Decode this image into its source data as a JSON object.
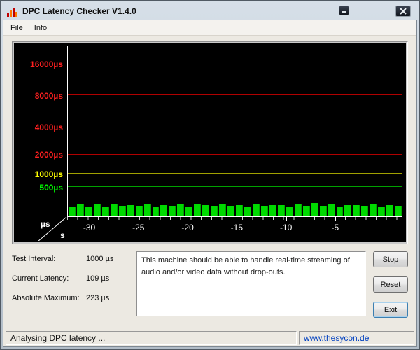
{
  "window": {
    "title": "DPC Latency Checker V1.4.0",
    "icons": {
      "app": "bar-chart-icon",
      "minimize": "minimize-icon",
      "close": "close-icon"
    }
  },
  "menu": {
    "items": [
      {
        "label": "File"
      },
      {
        "label": "Info"
      }
    ]
  },
  "chart_data": {
    "type": "bar",
    "y_scale": "log-like, linear below 500µs",
    "ylim": [
      0,
      16000
    ],
    "unit_y": "µs",
    "unit_x": "s",
    "y_axis": [
      {
        "value": 500,
        "label": "500µs",
        "color": "#00ff00",
        "line_color": "#00a000",
        "frac": 0.173
      },
      {
        "value": 1000,
        "label": "1000µs",
        "color": "#ffff00",
        "line_color": "#a0a000",
        "frac": 0.25
      },
      {
        "value": 2000,
        "label": "2000µs",
        "color": "#ff2020",
        "line_color": "#b00000",
        "frac": 0.363
      },
      {
        "value": 4000,
        "label": "4000µs",
        "color": "#ff2020",
        "line_color": "#b00000",
        "frac": 0.524
      },
      {
        "value": 8000,
        "label": "8000µs",
        "color": "#ff2020",
        "line_color": "#b00000",
        "frac": 0.71
      },
      {
        "value": 16000,
        "label": "16000µs",
        "color": "#ff2020",
        "line_color": "#b00000",
        "frac": 0.895
      }
    ],
    "x_ticks": [
      "-30",
      "-25",
      "-20",
      "-15",
      "-10",
      "-5"
    ],
    "x_tick_fracs": [
      0.066,
      0.213,
      0.36,
      0.507,
      0.654,
      0.801
    ],
    "bar_color": "#00da00",
    "values": [
      172,
      206,
      168,
      198,
      160,
      212,
      175,
      192,
      184,
      206,
      170,
      196,
      181,
      216,
      165,
      201,
      188,
      173,
      210,
      180,
      196,
      167,
      205,
      178,
      191,
      186,
      172,
      208,
      182,
      223,
      174,
      203,
      169,
      194,
      187,
      177,
      199,
      171,
      189,
      183
    ]
  },
  "stats": [
    {
      "label": "Test Interval:",
      "value": "1000 µs"
    },
    {
      "label": "Current Latency:",
      "value": "109 µs"
    },
    {
      "label": "Absolute Maximum:",
      "value": "223 µs"
    }
  ],
  "message": {
    "text": "This machine should be able to handle real-time streaming of audio and/or video data without drop-outs."
  },
  "buttons": [
    {
      "label": "Stop",
      "focused": false
    },
    {
      "label": "Reset",
      "focused": false
    },
    {
      "label": "Exit",
      "focused": true
    }
  ],
  "status": {
    "text": "Analysing DPC latency ...",
    "link": "www.thesycon.de"
  }
}
